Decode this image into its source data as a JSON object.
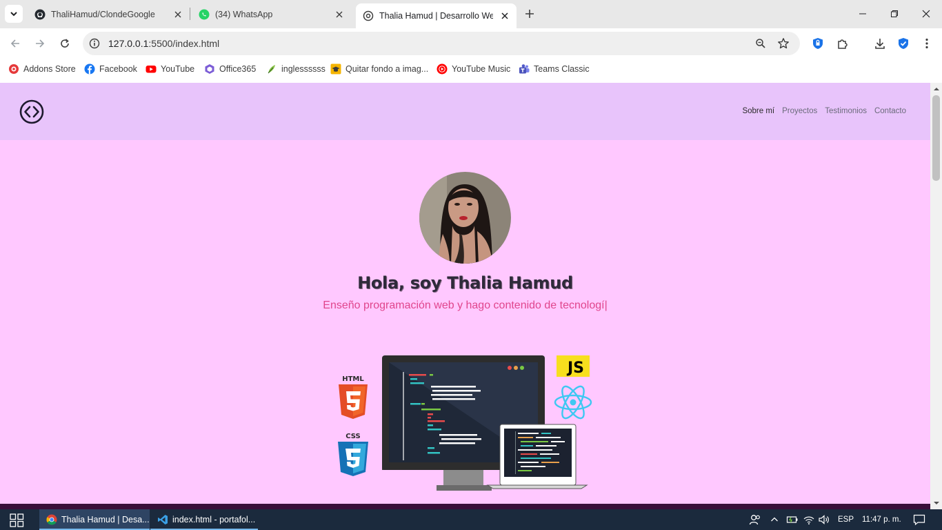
{
  "browser": {
    "tabs": [
      {
        "title": "ThaliHamud/ClondeGoogle",
        "favicon": "github-icon"
      },
      {
        "title": "(34) WhatsApp",
        "favicon": "whatsapp-icon"
      },
      {
        "title": "Thalia Hamud | Desarrollo Web",
        "favicon": "chrome-page-icon"
      }
    ],
    "active_tab_index": 2,
    "url_host": "127.0.0.1",
    "url_rest": ":5500/index.html",
    "bookmarks": [
      {
        "label": "Addons Store",
        "icon": "addons-icon"
      },
      {
        "label": "Facebook",
        "icon": "facebook-icon"
      },
      {
        "label": "YouTube",
        "icon": "youtube-icon"
      },
      {
        "label": "Office365",
        "icon": "office-icon"
      },
      {
        "label": "inglessssss",
        "icon": "leaf-icon"
      },
      {
        "label": "Quitar fondo a imag...",
        "icon": "hat-icon"
      },
      {
        "label": "YouTube Music",
        "icon": "youtube-music-icon"
      },
      {
        "label": "Teams Classic",
        "icon": "teams-icon"
      }
    ]
  },
  "site": {
    "nav": [
      "Sobre mí",
      "Proyectos",
      "Testimonios",
      "Contacto"
    ],
    "hero_title": "Hola, soy Thalia Hamud",
    "hero_subtitle": "Enseño programación web y hago contenido de tecnologí",
    "caret": "|",
    "badges": {
      "html": "HTML",
      "css": "CSS",
      "js": "JS"
    }
  },
  "taskbar": {
    "apps": [
      {
        "label": "Thalia Hamud | Desa...",
        "icon": "chrome-icon",
        "active": true
      },
      {
        "label": "index.html - portafol...",
        "icon": "vscode-icon",
        "active": false
      }
    ],
    "language": "ESP",
    "time": "11:47 p. m."
  },
  "colors": {
    "page_bg": "#ffc8ff",
    "header_bg": "#e8c4fb",
    "accent_pink": "#e0458c",
    "taskbar_bg": "#1b2a3d"
  }
}
